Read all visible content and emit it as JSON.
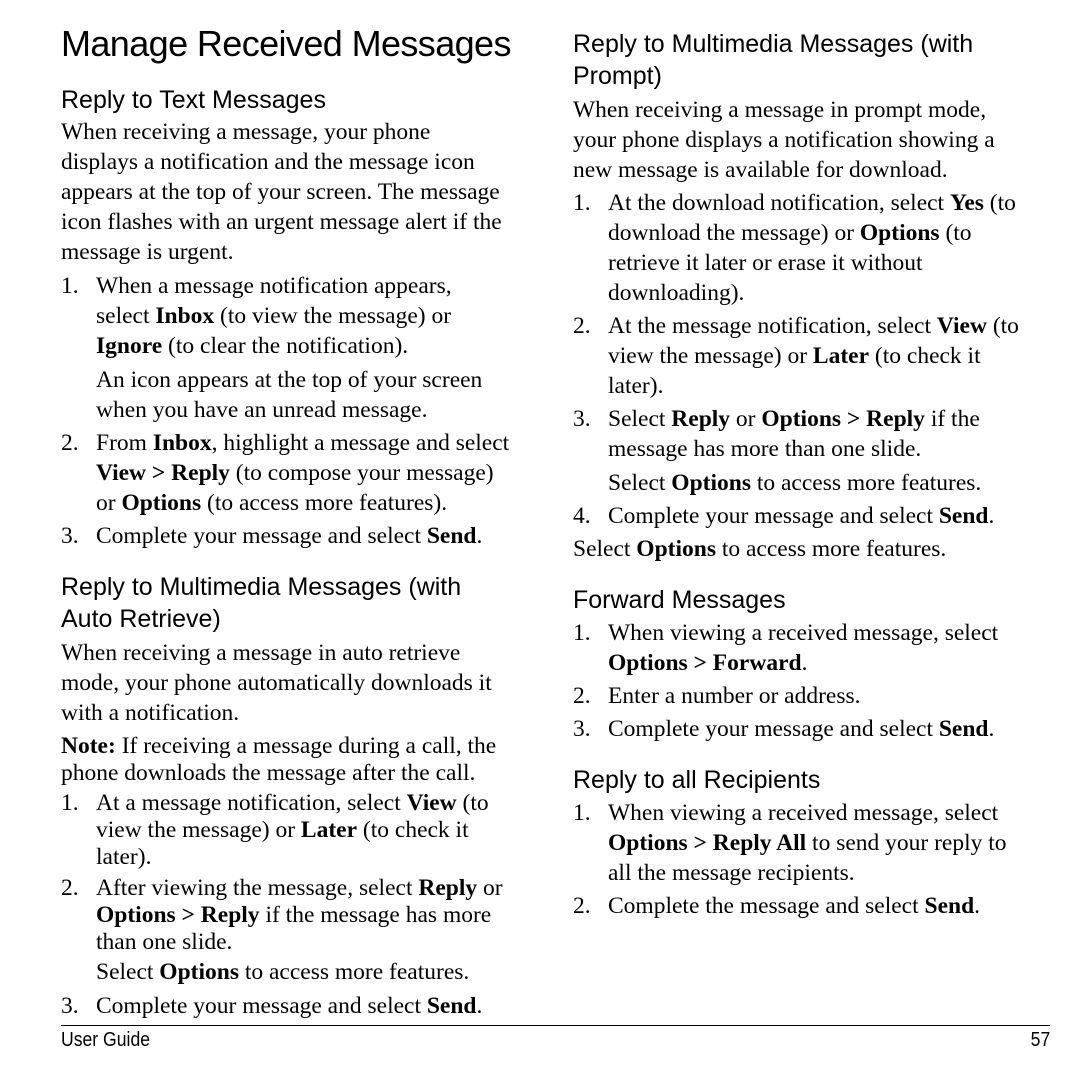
{
  "page_title": "Manage Received Messages",
  "left": {
    "text_messages": {
      "heading": "Reply to Text Messages",
      "intro_lines": [
        "When receiving a message, your phone",
        "displays a notification and the message icon",
        "appears at the top of your screen. The message",
        "icon flashes with an urgent message alert if the",
        "message is urgent."
      ],
      "steps": [
        {
          "num": "1.",
          "lines": [
            [
              {
                "t": "When a message notification appears,"
              }
            ],
            [
              {
                "t": "select "
              },
              {
                "b": "Inbox"
              },
              {
                "t": " (to view the message) or"
              }
            ],
            [
              {
                "b": "Ignore"
              },
              {
                "t": " (to clear the notification)."
              }
            ]
          ],
          "note_lines": [
            [
              {
                "t": "An icon appears at the top of your screen"
              }
            ],
            [
              {
                "t": "when you have an unread message."
              }
            ]
          ]
        },
        {
          "num": "2.",
          "lines": [
            [
              {
                "t": "From "
              },
              {
                "b": "Inbox"
              },
              {
                "t": ", highlight a message and select"
              }
            ],
            [
              {
                "b": "View > Reply"
              },
              {
                "t": " (to compose your message)"
              }
            ],
            [
              {
                "t": "or "
              },
              {
                "b": "Options"
              },
              {
                "t": " (to access more features)."
              }
            ]
          ]
        },
        {
          "num": "3.",
          "lines": [
            [
              {
                "t": "Complete your message and select "
              },
              {
                "b": "Send"
              },
              {
                "t": "."
              }
            ]
          ]
        }
      ]
    },
    "auto_retrieve": {
      "heading_lines": [
        "Reply to Multimedia Messages (with",
        "Auto Retrieve)"
      ],
      "intro_lines": [
        "When receiving a message in auto retrieve",
        "mode, your phone automatically downloads it",
        "with a notification."
      ],
      "note_lines": [
        [
          {
            "b": "Note:"
          },
          {
            "t": " If receiving a message during a call, the"
          }
        ],
        [
          {
            "t": "phone downloads the message after the call."
          }
        ]
      ],
      "steps": [
        {
          "num": "1.",
          "lines": [
            [
              {
                "t": "At a message notification, select "
              },
              {
                "b": "View"
              },
              {
                "t": " (to"
              }
            ],
            [
              {
                "t": "view the message) or "
              },
              {
                "b": "Later"
              },
              {
                "t": " (to check it"
              }
            ],
            [
              {
                "t": "later)."
              }
            ]
          ]
        },
        {
          "num": "2.",
          "lines": [
            [
              {
                "t": "After viewing the message, select "
              },
              {
                "b": "Reply"
              },
              {
                "t": " or"
              }
            ],
            [
              {
                "b": "Options > Reply"
              },
              {
                "t": " if the message has more"
              }
            ],
            [
              {
                "t": "than one slide."
              }
            ]
          ],
          "note_lines": [
            [
              {
                "t": "Select "
              },
              {
                "b": "Options"
              },
              {
                "t": " to access more features."
              }
            ]
          ]
        },
        {
          "num": "3.",
          "lines": [
            [
              {
                "t": "Complete your message and select "
              },
              {
                "b": "Send"
              },
              {
                "t": "."
              }
            ]
          ]
        }
      ]
    }
  },
  "right": {
    "prompt": {
      "heading_lines": [
        "Reply to Multimedia Messages (with",
        "Prompt)"
      ],
      "intro_lines": [
        "When receiving a message in prompt mode,",
        "your phone displays a notification showing a",
        "new message is available for download."
      ],
      "steps": [
        {
          "num": "1.",
          "lines": [
            [
              {
                "t": "At the download notification, select "
              },
              {
                "b": "Yes"
              },
              {
                "t": " (to"
              }
            ],
            [
              {
                "t": "download the message) or "
              },
              {
                "b": "Options"
              },
              {
                "t": " (to"
              }
            ],
            [
              {
                "t": "retrieve it later or erase it without"
              }
            ],
            [
              {
                "t": "downloading)."
              }
            ]
          ]
        },
        {
          "num": "2.",
          "lines": [
            [
              {
                "t": "At the message notification, select "
              },
              {
                "b": "View"
              },
              {
                "t": " (to"
              }
            ],
            [
              {
                "t": "view the message) or "
              },
              {
                "b": "Later"
              },
              {
                "t": " (to check it"
              }
            ],
            [
              {
                "t": "later)."
              }
            ]
          ]
        },
        {
          "num": "3.",
          "lines": [
            [
              {
                "t": "Select "
              },
              {
                "b": "Reply"
              },
              {
                "t": " or "
              },
              {
                "b": "Options > Reply"
              },
              {
                "t": " if the"
              }
            ],
            [
              {
                "t": "message has more than one slide."
              }
            ]
          ],
          "note_lines": [
            [
              {
                "t": "Select "
              },
              {
                "b": "Options"
              },
              {
                "t": " to access more features."
              }
            ]
          ]
        },
        {
          "num": "4.",
          "lines": [
            [
              {
                "t": "Complete your message and select "
              },
              {
                "b": "Send"
              },
              {
                "t": "."
              }
            ]
          ]
        }
      ],
      "trailing": [
        {
          "t": "Select "
        },
        {
          "b": "Options"
        },
        {
          "t": " to access more features."
        }
      ]
    },
    "forward": {
      "heading": "Forward Messages",
      "steps": [
        {
          "num": "1.",
          "lines": [
            [
              {
                "t": "When viewing a received message, select"
              }
            ],
            [
              {
                "b": "Options > Forward"
              },
              {
                "t": "."
              }
            ]
          ]
        },
        {
          "num": "2.",
          "lines": [
            [
              {
                "t": "Enter a number or address."
              }
            ]
          ]
        },
        {
          "num": "3.",
          "lines": [
            [
              {
                "t": "Complete your message and select "
              },
              {
                "b": "Send"
              },
              {
                "t": "."
              }
            ]
          ]
        }
      ]
    },
    "reply_all": {
      "heading": "Reply to all Recipients",
      "steps": [
        {
          "num": "1.",
          "lines": [
            [
              {
                "t": "When viewing a received message, select"
              }
            ],
            [
              {
                "b": "Options > Reply All"
              },
              {
                "t": " to send your reply to"
              }
            ],
            [
              {
                "t": "all the message recipients."
              }
            ]
          ]
        },
        {
          "num": "2.",
          "lines": [
            [
              {
                "t": "Complete the message and select "
              },
              {
                "b": "Send"
              },
              {
                "t": "."
              }
            ]
          ]
        }
      ]
    }
  },
  "footer": {
    "label": "User Guide",
    "page_number": "57"
  }
}
